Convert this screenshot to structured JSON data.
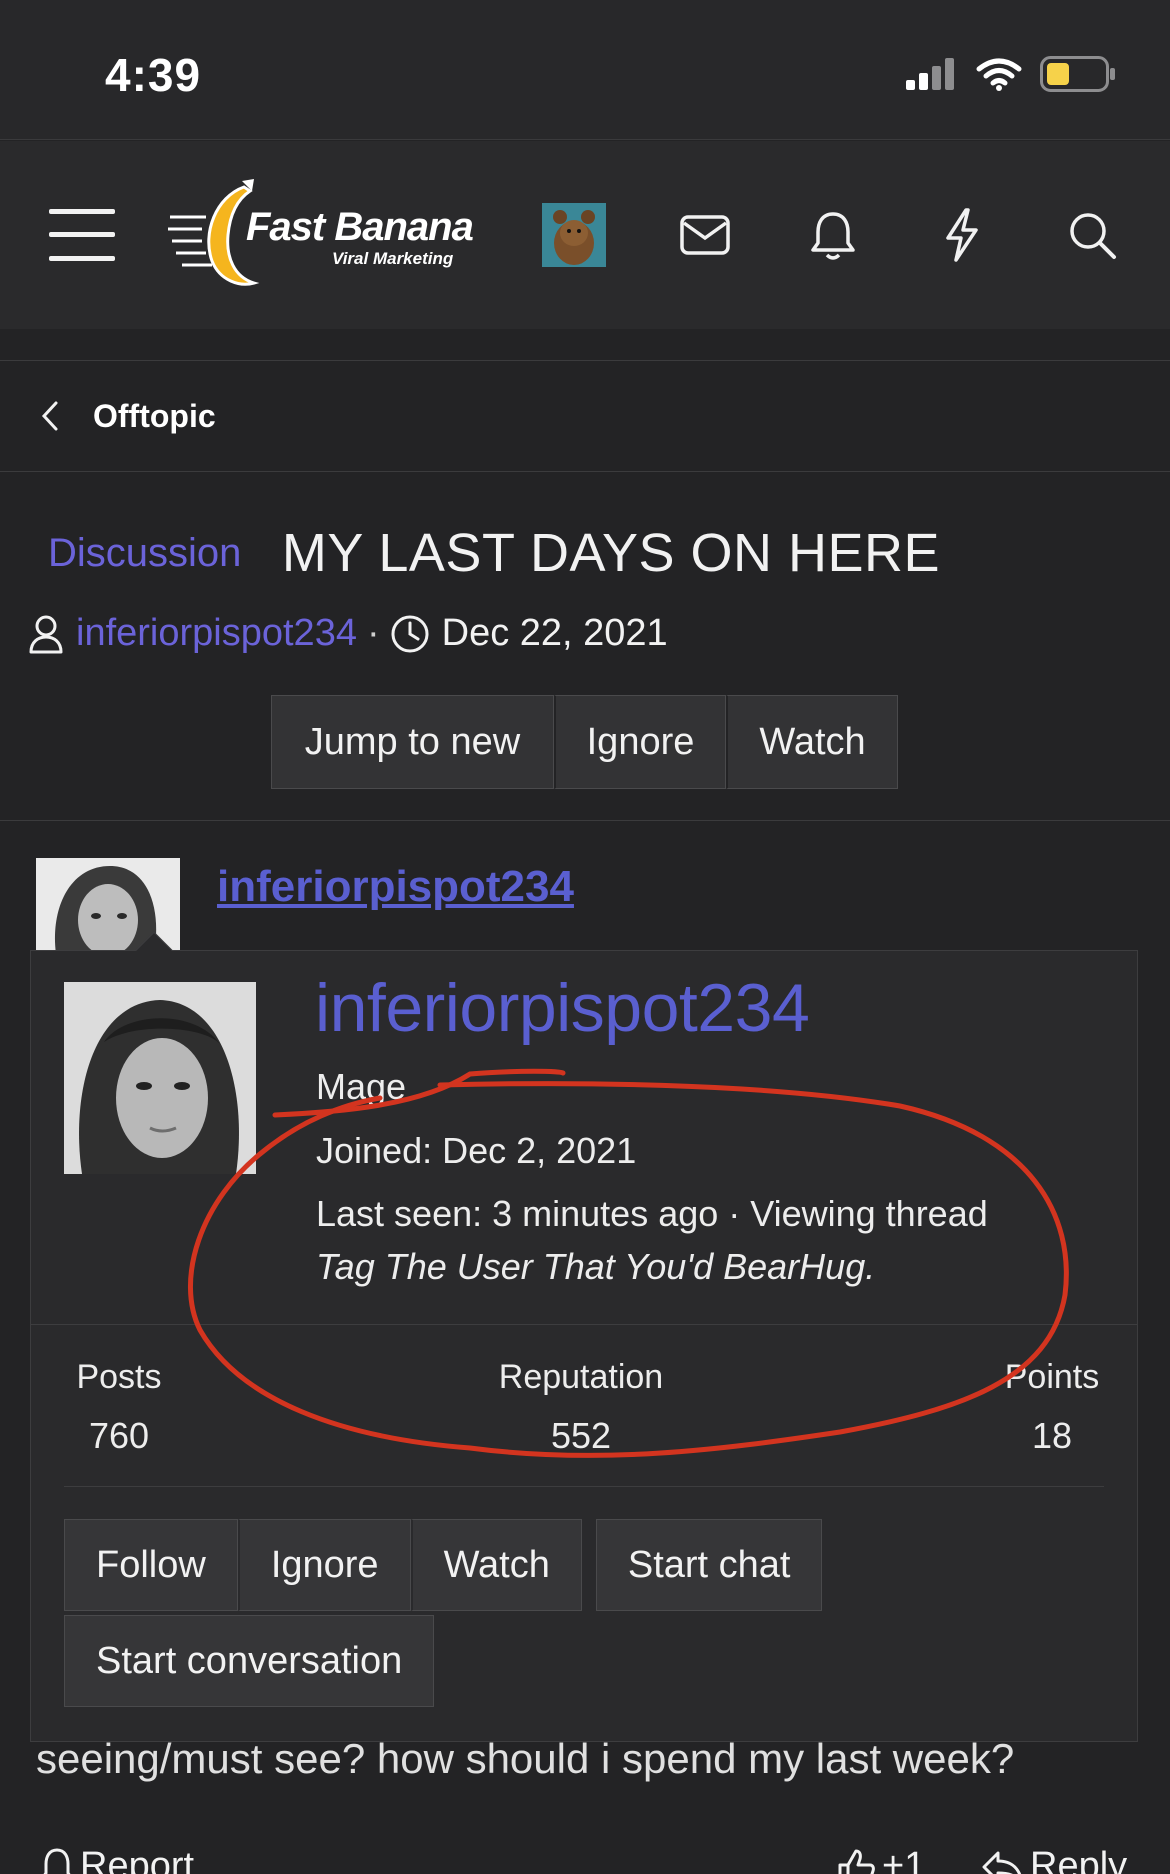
{
  "status_bar": {
    "time": "4:39"
  },
  "navbar": {
    "logo_text": "Fast Banana",
    "logo_sub": "Viral Marketing"
  },
  "breadcrumb": {
    "label": "Offtopic"
  },
  "thread": {
    "prefix": "Discussion",
    "title": "MY LAST DAYS ON HERE",
    "author": "inferiorpispot234",
    "meta_separator": "·",
    "date": "Dec 22, 2021",
    "buttons": [
      "Jump to new",
      "Ignore",
      "Watch"
    ]
  },
  "post": {
    "author": "inferiorpispot234",
    "body_tail": "seeing/must see? how should i spend my last week?",
    "actions": {
      "report": "Report",
      "like": "+1",
      "reply": "Reply"
    }
  },
  "member_popup": {
    "username": "inferiorpispot234",
    "user_title": "Mage",
    "joined": "Joined: Dec 2, 2021",
    "last_seen": "Last seen: 3 minutes ago · Viewing thread",
    "activity_thread": "Tag The User That You'd BearHug.",
    "stats": [
      {
        "label": "Posts",
        "value": "760"
      },
      {
        "label": "Reputation",
        "value": "552"
      },
      {
        "label": "Points",
        "value": "18"
      }
    ],
    "buttons_row1": [
      "Follow",
      "Ignore",
      "Watch"
    ],
    "start_chat": "Start chat",
    "start_conversation": "Start conversation"
  },
  "colors": {
    "accent_link": "#5a5fd0",
    "prefix_purple": "#6b63d9",
    "annotation_red": "#d3341f",
    "banana_yellow": "#f5b51e"
  },
  "icons": [
    "hamburger-menu-icon",
    "mail-icon",
    "bell-icon",
    "lightning-icon",
    "search-icon",
    "chevron-left-icon",
    "user-icon",
    "clock-icon",
    "bell-icon",
    "thumbs-up-icon",
    "reply-icon"
  ]
}
